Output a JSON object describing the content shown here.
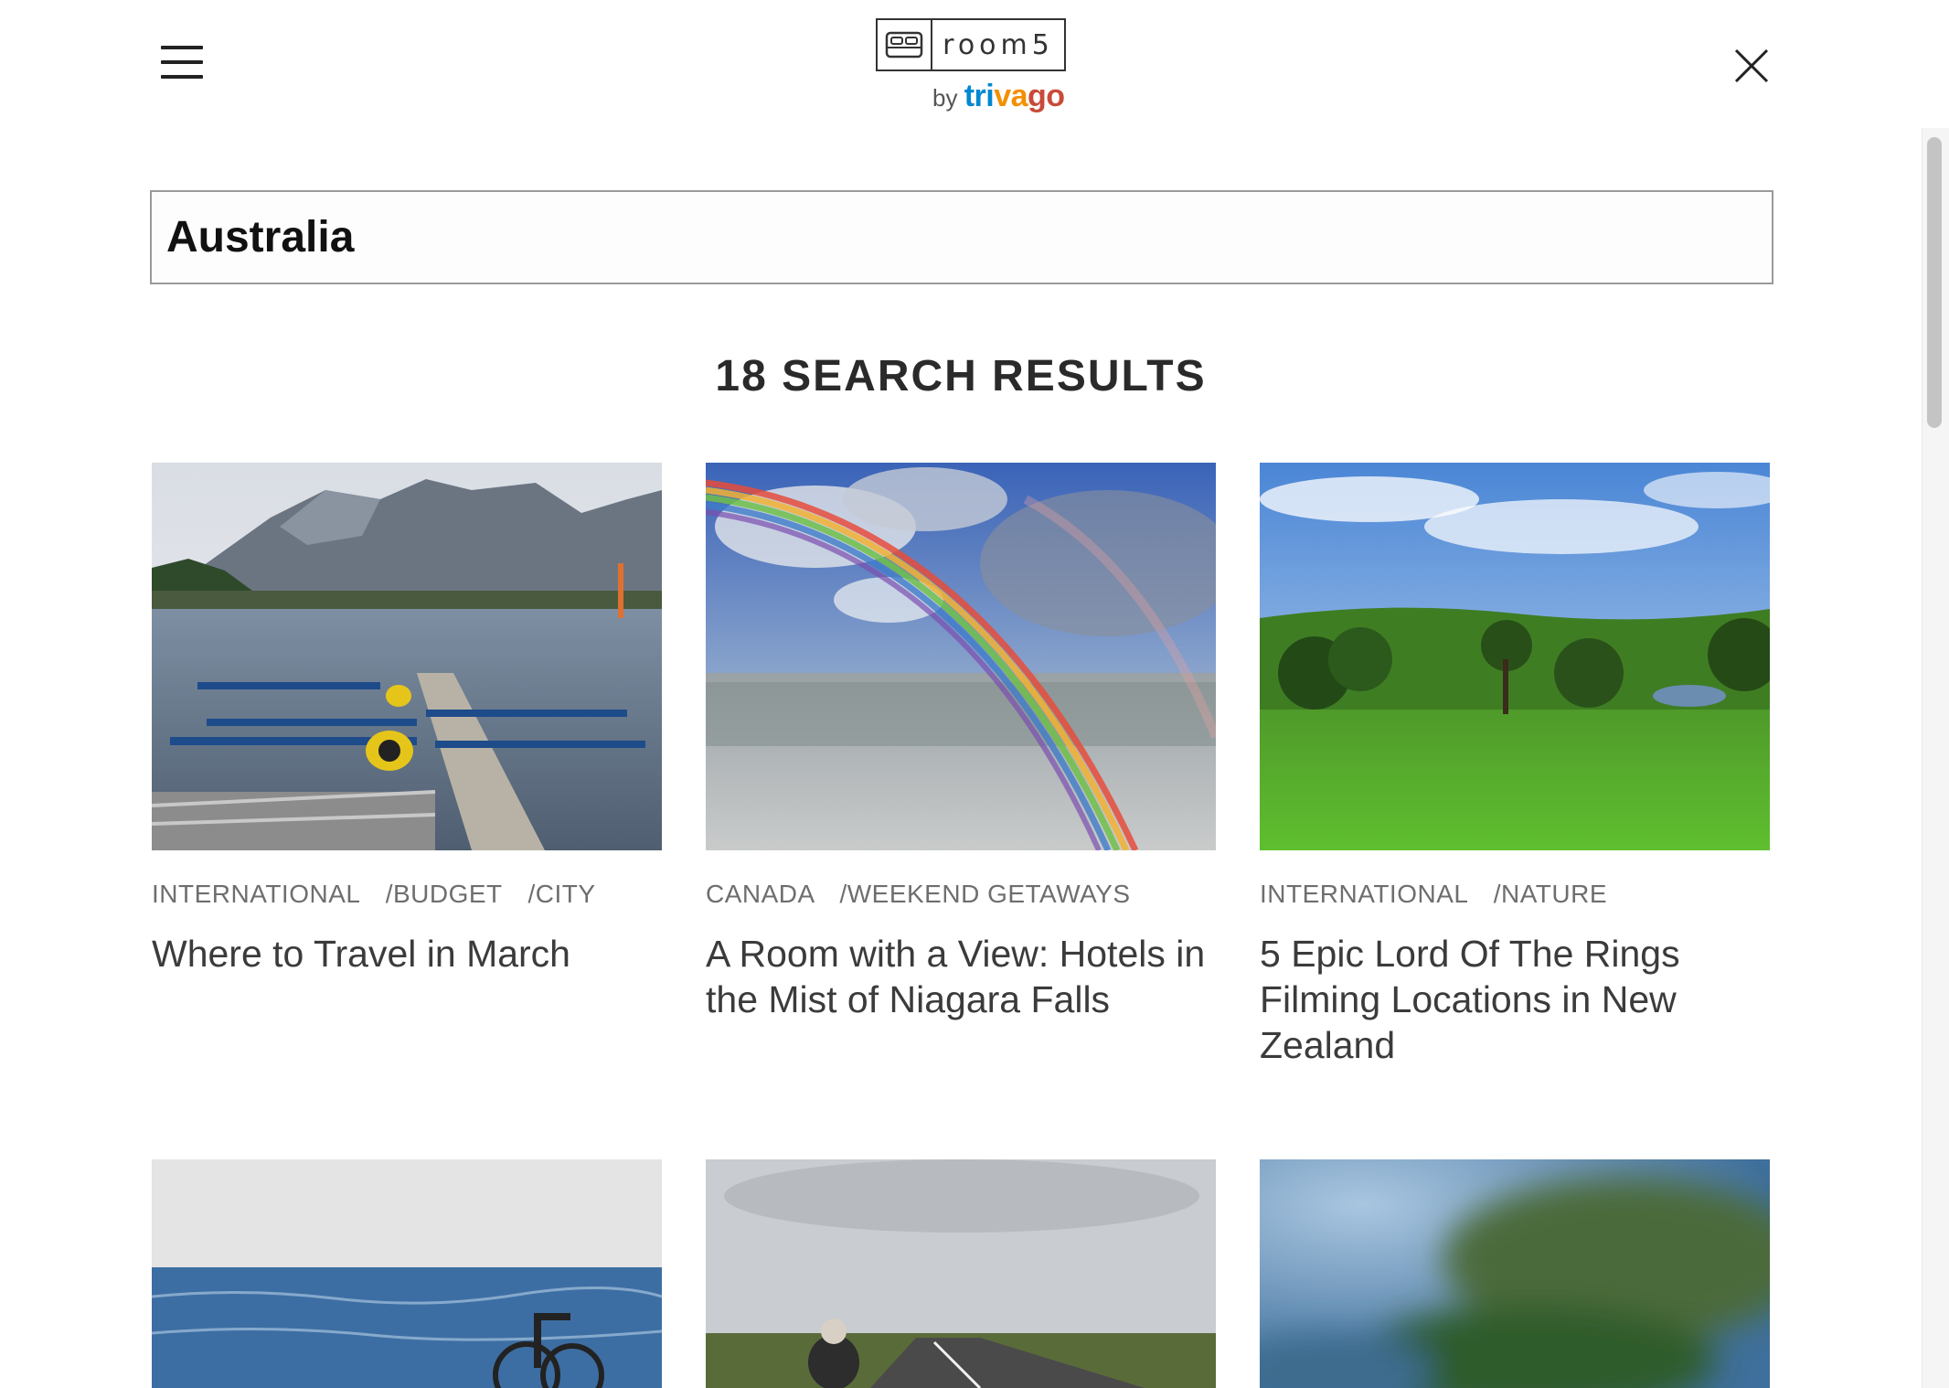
{
  "header": {
    "logo_word": "room5",
    "logo_by": "by",
    "logo_brand": [
      "tri",
      "va",
      "go"
    ],
    "colors": {
      "brand_blue": "#0088d1",
      "brand_orange": "#f48f00",
      "brand_red": "#c94a38"
    }
  },
  "search": {
    "value": "Australia"
  },
  "results": {
    "heading": "18 SEARCH RESULTS",
    "cards": [
      {
        "tags": [
          "INTERNATIONAL",
          "BUDGET",
          "CITY"
        ],
        "title": "Where to Travel in March",
        "image": "seaplanes-harbor-mountains"
      },
      {
        "tags": [
          "CANADA",
          "WEEKEND GETAWAYS"
        ],
        "title": "A Room with a View: Hotels in the Mist of Niagara Falls",
        "image": "rainbow-over-falls"
      },
      {
        "tags": [
          "INTERNATIONAL",
          "NATURE"
        ],
        "title": "5 Epic Lord Of The Rings Filming Locations in New Zealand",
        "image": "green-hills-trees"
      },
      {
        "tags": [],
        "title": "",
        "image": "wheelchair-by-sea"
      },
      {
        "tags": [],
        "title": "",
        "image": "road-lava-fields"
      },
      {
        "tags": [],
        "title": "",
        "image": "blurred-coastline"
      }
    ]
  },
  "tag_separator": "/",
  "icons": {
    "menu": "hamburger-menu-icon",
    "close": "close-icon",
    "bed": "bed-icon"
  }
}
